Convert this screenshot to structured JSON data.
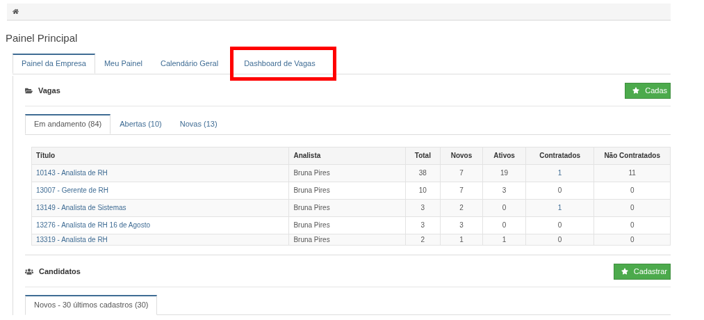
{
  "page_title": "Painel Principal",
  "tabs": [
    {
      "label": "Painel da Empresa",
      "selected": true,
      "highlighted": false
    },
    {
      "label": "Meu Painel",
      "selected": false,
      "highlighted": false
    },
    {
      "label": "Calendário Geral",
      "selected": false,
      "highlighted": false
    },
    {
      "label": "Dashboard de Vagas",
      "selected": false,
      "highlighted": true
    }
  ],
  "vagas": {
    "title": "Vagas",
    "button": "Cadas",
    "tabs": [
      {
        "label": "Em andamento (84)",
        "selected": true
      },
      {
        "label": "Abertas (10)",
        "selected": false
      },
      {
        "label": "Novas (13)",
        "selected": false
      }
    ],
    "table": {
      "columns": [
        "Título",
        "Analista",
        "Total",
        "Novos",
        "Ativos",
        "Contratados",
        "Não Contratados"
      ],
      "rows": [
        {
          "title": "10143 - Analista de RH",
          "analyst": "Bruna Pires",
          "total": "38",
          "novos": "7",
          "ativos": "19",
          "contratados": {
            "text": "1",
            "link": true
          },
          "nao_contratados": "11"
        },
        {
          "title": "13007 - Gerente de RH",
          "analyst": "Bruna Pires",
          "total": "10",
          "novos": "7",
          "ativos": "3",
          "contratados": {
            "text": "0",
            "link": false
          },
          "nao_contratados": "0"
        },
        {
          "title": "13149 - Analista de Sistemas",
          "analyst": "Bruna Pires",
          "total": "3",
          "novos": "2",
          "ativos": "0",
          "contratados": {
            "text": "1",
            "link": true
          },
          "nao_contratados": "0"
        },
        {
          "title": "13276 - Analista de RH 16 de Agosto",
          "analyst": "Bruna Pires",
          "total": "3",
          "novos": "3",
          "ativos": "0",
          "contratados": {
            "text": "0",
            "link": false
          },
          "nao_contratados": "0"
        },
        {
          "title": "13319 - Analista de RH",
          "analyst": "Bruna Pires",
          "total": "2",
          "novos": "1",
          "ativos": "1",
          "contratados": {
            "text": "0",
            "link": false
          },
          "nao_contratados": "0"
        }
      ]
    }
  },
  "candidatos": {
    "title": "Candidatos",
    "button": "Cadastrar",
    "tabs": [
      {
        "label": "Novos - 30 últimos cadastros (30)",
        "selected": true
      }
    ]
  }
}
